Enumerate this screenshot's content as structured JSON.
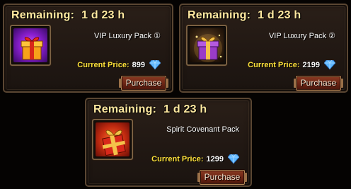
{
  "offers": [
    {
      "remaining_label": "Remaining:",
      "remaining_value": "1 d 23 h",
      "name": "VIP Luxury Pack ①",
      "price_label": "Current Price:",
      "price_value": "899",
      "currency_icon": "diamond-icon",
      "button_label": "Purchase",
      "item_icon": "purple-gift-box-icon"
    },
    {
      "remaining_label": "Remaining:",
      "remaining_value": "1 d 23 h",
      "name": "VIP Luxury Pack ②",
      "price_label": "Current Price:",
      "price_value": "2199",
      "currency_icon": "diamond-icon",
      "button_label": "Purchase",
      "item_icon": "glowing-purple-gift-box-icon"
    },
    {
      "remaining_label": "Remaining:",
      "remaining_value": "1 d 23 h",
      "name": "Spirit Covenant Pack",
      "price_label": "Current Price:",
      "price_value": "1299",
      "currency_icon": "diamond-icon",
      "button_label": "Purchase",
      "item_icon": "red-gift-box-icon"
    }
  ],
  "colors": {
    "remaining_text": "#ffe9a0",
    "price_label": "#ffe23a",
    "gem": "#5fb8ff"
  }
}
